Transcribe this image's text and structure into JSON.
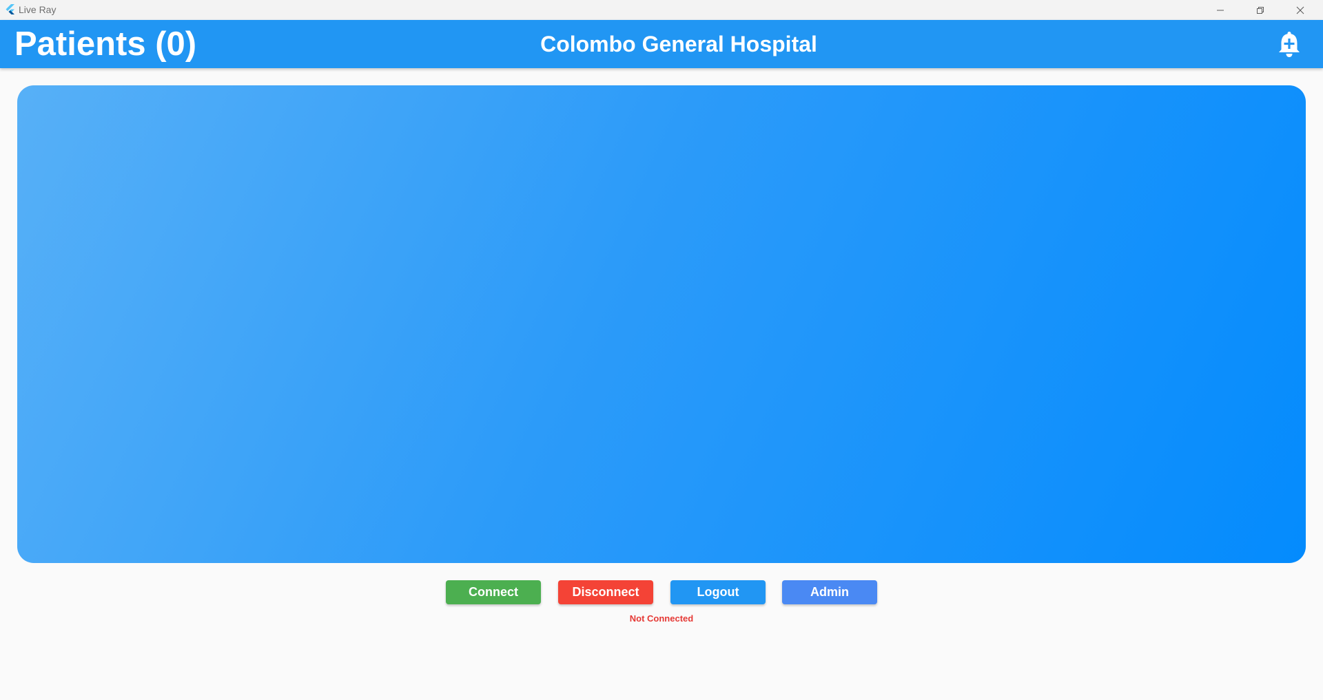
{
  "window": {
    "title": "Live Ray",
    "logo_icon": "flutter-logo-icon",
    "controls": [
      "minimize-icon",
      "restore-icon",
      "close-icon"
    ]
  },
  "appbar": {
    "title": "Patients (0)",
    "hospital": "Colombo General Hospital",
    "action_icon": "add-alert-bell-icon",
    "color": "#2196f3"
  },
  "panel": {
    "gradient_start": "#57b0f7",
    "gradient_end": "#048bfd"
  },
  "actions": {
    "connect": {
      "label": "Connect",
      "color": "#4caf50"
    },
    "disconnect": {
      "label": "Disconnect",
      "color": "#f44336"
    },
    "logout": {
      "label": "Logout",
      "color": "#2196f3"
    },
    "admin": {
      "label": "Admin",
      "color": "#4a89f3"
    }
  },
  "connection": {
    "status": "Not Connected",
    "status_color": "#e53935"
  }
}
